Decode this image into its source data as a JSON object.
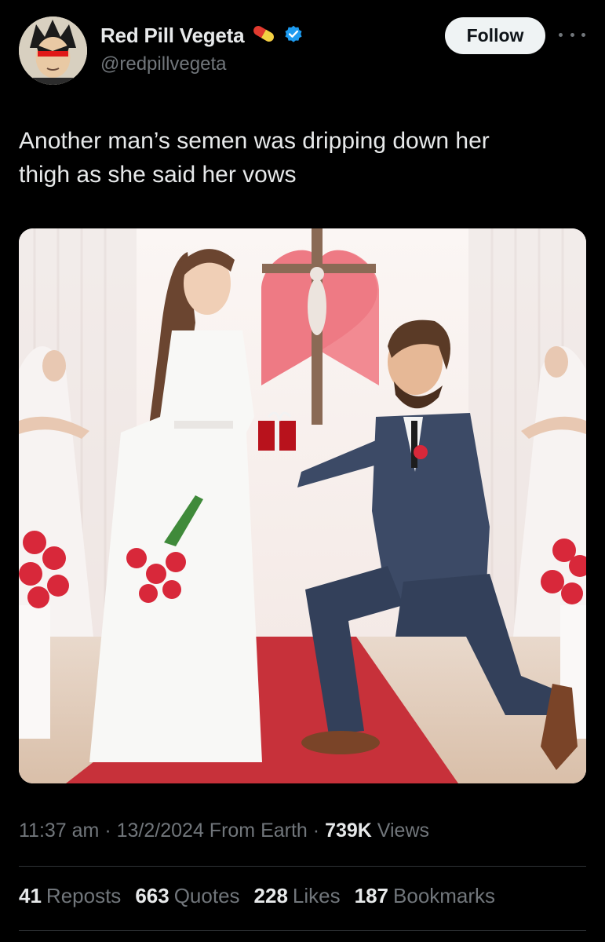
{
  "author": {
    "display_name": "Red Pill Vegeta",
    "handle": "@redpillvegeta",
    "emoji": "pill-emoji",
    "verified_icon": "verified-badge-icon",
    "verified_color": "#1d9bf0"
  },
  "actions": {
    "follow_label": "Follow",
    "more_icon": "more-horizontal-icon"
  },
  "tweet": {
    "text_line1": "Another man’s semen was dripping down her",
    "text_line2": "thigh as she said her vows"
  },
  "meta": {
    "time": "11:37 am",
    "date": "13/2/2024",
    "location": "From Earth",
    "views_count": "739K",
    "views_label": "Views",
    "separator": "·"
  },
  "stats": [
    {
      "count": "41",
      "label": "Reposts"
    },
    {
      "count": "663",
      "label": "Quotes"
    },
    {
      "count": "228",
      "label": "Likes"
    },
    {
      "count": "187",
      "label": "Bookmarks"
    }
  ],
  "colors": {
    "background": "#000000",
    "text_primary": "#e7e9ea",
    "text_secondary": "#71767b",
    "follow_bg": "#eff3f4",
    "divider": "#2f3336"
  }
}
